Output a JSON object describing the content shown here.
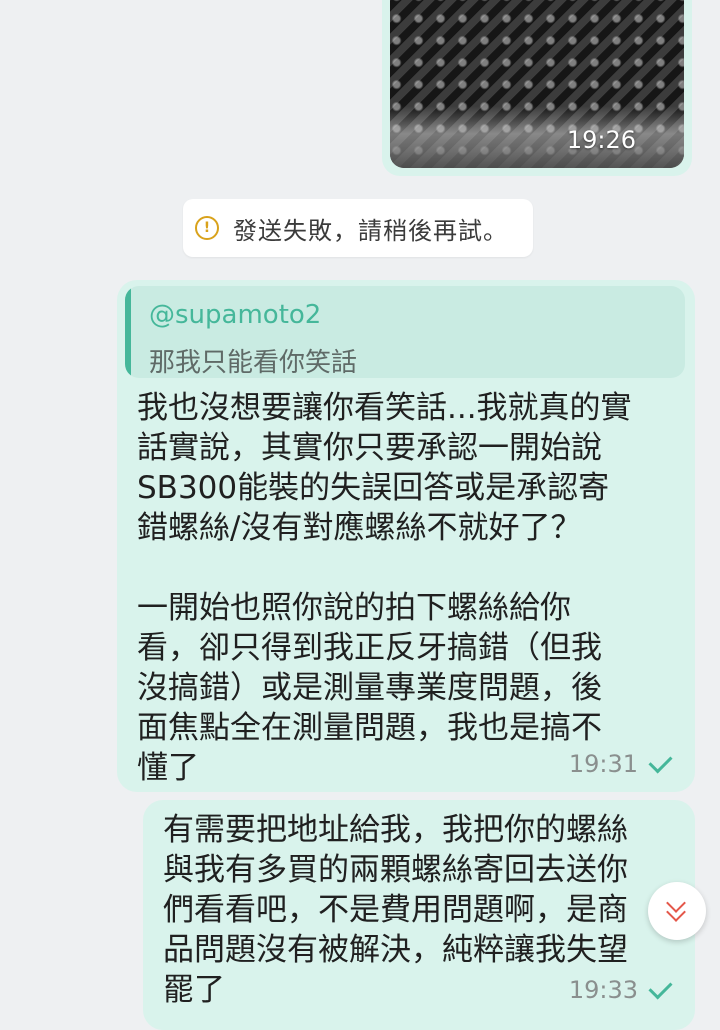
{
  "photo_message": {
    "time": "19:26"
  },
  "system_notice": {
    "text": "發送失敗，請稍後再試。",
    "icon": "warning-circle-icon"
  },
  "messages": [
    {
      "reply_to": {
        "user": "@supamoto2",
        "text": "那我只能看你笑話"
      },
      "text": "我也沒想要讓你看笑話...我就真的實\n話實說，其實你只要承認一開始說\nSB300能裝的失誤回答或是承認寄\n錯螺絲/沒有對應螺絲不就好了？\n\n一開始也照你說的拍下螺絲給你\n看，卻只得到我正反牙搞錯（但我\n沒搞錯）或是測量專業度問題，後\n面焦點全在測量問題，我也是搞不\n懂了",
      "time": "19:31",
      "status_icon": "checkmark-icon"
    },
    {
      "text": "有需要把地址給我，我把你的螺絲\n與我有多買的兩顆螺絲寄回去送你\n們看看吧，不是費用問題啊，是商\n品問題沒有被解決，純粹讓我失望\n罷了",
      "time": "19:33",
      "status_icon": "checkmark-icon"
    }
  ],
  "scroll_button": {
    "icon": "double-chevron-down-icon"
  },
  "colors": {
    "bubble": "#d9f3ec",
    "accent": "#45b79a",
    "warning": "#d9a21b",
    "scroll_chevron": "#e4574a"
  }
}
